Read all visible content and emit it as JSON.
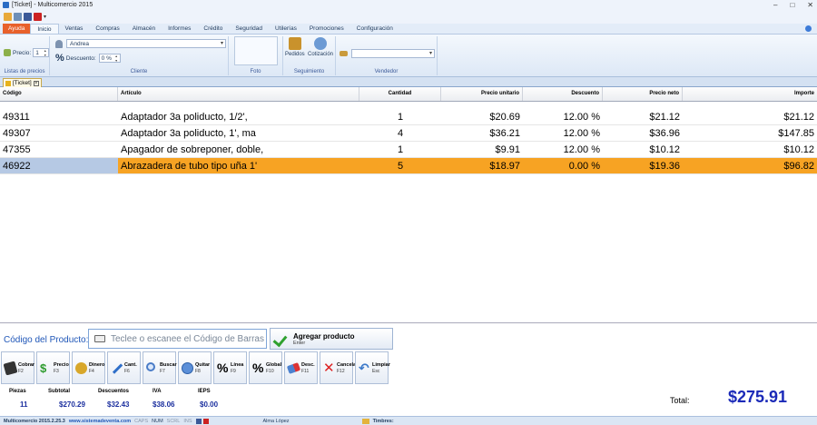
{
  "window": {
    "title": "[Ticket] - Multicomercio 2015",
    "controls": [
      "–",
      "□",
      "✕"
    ]
  },
  "tabs": [
    {
      "label": "Ayuda",
      "kind": "file"
    },
    {
      "label": "Inicio",
      "kind": "active"
    },
    {
      "label": "Ventas"
    },
    {
      "label": "Compras"
    },
    {
      "label": "Almacén"
    },
    {
      "label": "Informes"
    },
    {
      "label": "Crédito"
    },
    {
      "label": "Seguridad"
    },
    {
      "label": "Utilerías"
    },
    {
      "label": "Promociones"
    },
    {
      "label": "Configuración"
    }
  ],
  "ribbon": {
    "precios": {
      "price_label": "Precio:",
      "price_value": "1",
      "group_label": "Listas de precios"
    },
    "cliente": {
      "client_value": "Andrea",
      "discount_label": "Descuento:",
      "discount_value": "0 %",
      "group_label": "Cliente"
    },
    "foto": {
      "group_label": "Foto"
    },
    "seguimiento": {
      "pedidos_label": "Pedidos",
      "cotizacion_label": "Cotización",
      "group_label": "Seguimiento"
    },
    "vendedor": {
      "vendor_value": "",
      "group_label": "Vendedor"
    }
  },
  "doc_tab": {
    "label": "[Ticket]"
  },
  "grid": {
    "columns": [
      "Código",
      "Artículo",
      "Cantidad",
      "Precio unitario",
      "Descuento",
      "Precio neto",
      "Importe"
    ],
    "rows": [
      {
        "codigo": "49311",
        "articulo": "Adaptador 3a poliducto, 1/2',",
        "cantidad": "1",
        "precio": "$20.69",
        "descuento": "12.00 %",
        "neto": "$21.12",
        "importe": "$21.12"
      },
      {
        "codigo": "49307",
        "articulo": "Adaptador 3a poliducto, 1', ma",
        "cantidad": "4",
        "precio": "$36.21",
        "descuento": "12.00 %",
        "neto": "$36.96",
        "importe": "$147.85"
      },
      {
        "codigo": "47355",
        "articulo": "Apagador de sobreponer, doble,",
        "cantidad": "1",
        "precio": "$9.91",
        "descuento": "12.00 %",
        "neto": "$10.12",
        "importe": "$10.12"
      },
      {
        "codigo": "46922",
        "articulo": "Abrazadera de tubo tipo uña 1'",
        "cantidad": "5",
        "precio": "$18.97",
        "descuento": "0.00 %",
        "neto": "$19.36",
        "importe": "$96.82"
      }
    ],
    "selected_index": 3,
    "selected_color": "#f7a323"
  },
  "entry": {
    "label": "Código del Producto:",
    "placeholder": "Teclee o escanee el Código de Barras",
    "add_label": "Agregar producto",
    "add_key": "Enter"
  },
  "function_buttons": [
    {
      "label": "Cobrar",
      "key": "F2",
      "icon": "wallet-icon"
    },
    {
      "label": "Precio",
      "key": "F3",
      "icon": "dollar-icon"
    },
    {
      "label": "Dinero",
      "key": "F4",
      "icon": "coins-icon"
    },
    {
      "label": "Cant.",
      "key": "F6",
      "icon": "pencil-icon"
    },
    {
      "label": "Buscar",
      "key": "F7",
      "icon": "magnifier-icon"
    },
    {
      "label": "Quitar",
      "key": "F8",
      "icon": "minus-icon"
    },
    {
      "label": "Línea",
      "key": "F9",
      "icon": "percent-icon"
    },
    {
      "label": "Global",
      "key": "F10",
      "icon": "percent-icon"
    },
    {
      "label": "Desc.",
      "key": "F11",
      "icon": "eraser-icon"
    },
    {
      "label": "Cancela",
      "key": "F12",
      "icon": "cross-icon"
    },
    {
      "label": "Limpiar",
      "key": "Esc",
      "icon": "undo-arrow-icon"
    }
  ],
  "totals": {
    "piezas_label": "Piezas",
    "piezas": "11",
    "subtotal_label": "Subtotal",
    "subtotal": "$270.29",
    "descuentos_label": "Descuentos",
    "descuentos": "$32.43",
    "iva_label": "IVA",
    "iva": "$38.06",
    "ieps_label": "IEPS",
    "ieps": "$0.00",
    "total_label": "Total:",
    "total": "$275.91"
  },
  "status": {
    "version": "Multicomercio 2015.2.25.3",
    "website": "www.sistemadeventa.com",
    "caps": "CAPS",
    "num": "NUM",
    "scrl": "SCRL",
    "ins": "INS",
    "user": "Alma López",
    "timbres": "Timbres:"
  }
}
